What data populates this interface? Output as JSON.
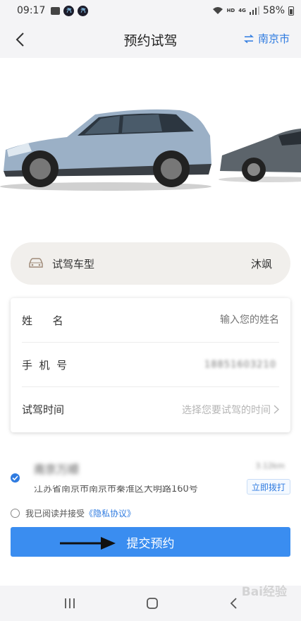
{
  "status_bar": {
    "time": "09:17",
    "network": "4G",
    "hd": "HD",
    "battery": "58%"
  },
  "header": {
    "title": "预约试驾",
    "city": "南京市"
  },
  "model": {
    "label": "试驾车型",
    "value": "沐飒"
  },
  "form": {
    "name_label": "姓      名",
    "name_placeholder": "输入您的姓名",
    "phone_label": "手  机  号",
    "phone_value": "18851603210",
    "time_label": "试驾时间",
    "time_placeholder": "选择您要试驾的时间"
  },
  "dealer": {
    "name": "南京万顺",
    "distance": "3.12km",
    "address": "江苏省南京市南京市秦淮区大明路160号",
    "call_label": "立即拨打"
  },
  "agreement": {
    "text": "我已阅读并接受",
    "link": "《隐私协议》"
  },
  "submit_label": "提交预约",
  "watermark": "Bai经验",
  "colors": {
    "accent": "#2f7be0",
    "button": "#3a8df0",
    "model_bg": "#f1efec"
  }
}
